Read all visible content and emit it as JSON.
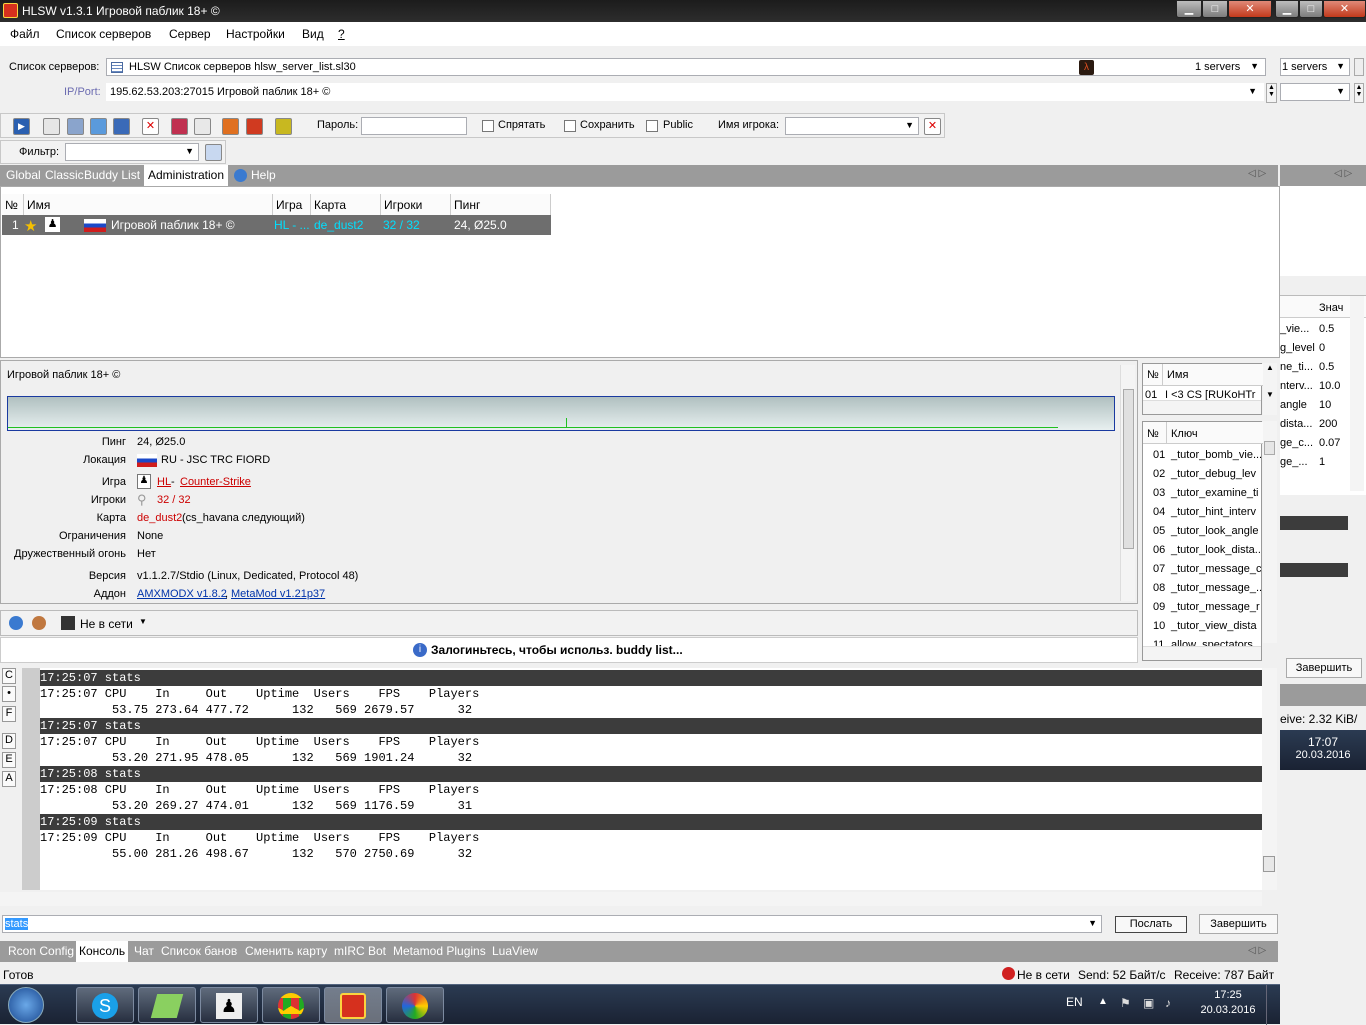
{
  "window": {
    "title": "HLSW v1.3.1   Игровой паблик 18+ ©"
  },
  "menu": [
    "Файл",
    "Список серверов",
    "Сервер",
    "Настройки",
    "Вид",
    "?"
  ],
  "serverlist": {
    "label": "Список серверов:",
    "value": "HLSW Список серверов  hlsw_server_list.sl30",
    "count": "1 servers",
    "count2": "1 servers"
  },
  "ipport": {
    "label": "IP/Port:",
    "value": "195.62.53.203:27015 Игровой паблик 18+ ©"
  },
  "toolbar": {
    "password_label": "Пароль:",
    "hide_label": "Спрятать",
    "save_label": "Сохранить",
    "public_label": "Public",
    "player_label": "Имя игрока:"
  },
  "filter": {
    "label": "Фильтр:"
  },
  "tabs": [
    "Global",
    "Classic",
    "Buddy List",
    "Administration",
    "Help"
  ],
  "grid": {
    "headers": [
      "№",
      "Имя",
      "Игра",
      "Карта",
      "Игроки",
      "Пинг"
    ],
    "row": {
      "num": "1",
      "name": "Игровой паблик 18+ ©",
      "game": "HL - ...",
      "map": "de_dust2",
      "players": "32 / 32",
      "ping": "24, Ø25.0"
    }
  },
  "info": {
    "title": "Игровой паблик 18+ ©",
    "rows": [
      {
        "k": "Пинг",
        "v": "24, Ø25.0"
      },
      {
        "k": "Локация",
        "v": "RU - JSC TRC FIORD"
      },
      {
        "k": "Игра",
        "v1": "HL",
        "sep": " - ",
        "v2": "Counter-Strike"
      },
      {
        "k": "Игроки",
        "v": "32 / 32"
      },
      {
        "k": "Карта",
        "v1": "de_dust2",
        "v2": " (cs_havana следующий)"
      },
      {
        "k": "Ограничения",
        "v": "None"
      },
      {
        "k": "Дружественный огонь",
        "v": "Нет"
      },
      {
        "k": "Версия",
        "v": "v1.1.2.7/Stdio (Linux, Dedicated, Protocol 48)"
      },
      {
        "k": "Аддон",
        "v1": "AMXMODX v1.8.2",
        "sep": ", ",
        "v2": "MetaMod v1.21p37"
      }
    ]
  },
  "players_panel": {
    "h_num": "№",
    "h_name": "Имя",
    "row_num": "01",
    "row_name": "I <3 CS [RUKoHTr"
  },
  "cvar_panel": {
    "h_num": "№",
    "h_key": "Ключ",
    "rows": [
      [
        "01",
        "_tutor_bomb_vie..."
      ],
      [
        "02",
        "_tutor_debug_lev"
      ],
      [
        "03",
        "_tutor_examine_ti"
      ],
      [
        "04",
        "_tutor_hint_interv"
      ],
      [
        "05",
        "_tutor_look_angle"
      ],
      [
        "06",
        "_tutor_look_dista..."
      ],
      [
        "07",
        "_tutor_message_c"
      ],
      [
        "08",
        "_tutor_message_..."
      ],
      [
        "09",
        "_tutor_message_r"
      ],
      [
        "10",
        "_tutor_view_dista"
      ],
      [
        "11",
        "allow_spectators"
      ]
    ]
  },
  "side_panel": {
    "h_val": "Знач",
    "rows": [
      [
        "_vie...",
        "0.5"
      ],
      [
        "g_level",
        "0"
      ],
      [
        "ne_ti...",
        "0.5"
      ],
      [
        "nterv...",
        "10.0"
      ],
      [
        "angle",
        "10"
      ],
      [
        "dista...",
        "200"
      ],
      [
        "ge_c...",
        "0.07"
      ],
      [
        "ge_...",
        "1"
      ]
    ],
    "finish": "Завершить",
    "recv": "eive:  2.32 KiB/",
    "time": "17:07",
    "date": "20.03.2016"
  },
  "buddy": {
    "status": "Не в сети",
    "notice": "Залогиньтесь, чтобы использ. buddy list..."
  },
  "side_letters": [
    "C",
    "•",
    "F",
    "D",
    "E",
    "A"
  ],
  "console": {
    "lines": [
      {
        "t": "h",
        "s": "17:25:07 stats"
      },
      {
        "t": "n",
        "s": "17:25:07 CPU    In     Out    Uptime  Users    FPS    Players"
      },
      {
        "t": "n",
        "s": "          53.75 273.64 477.72      132   569 2679.57      32"
      },
      {
        "t": "h",
        "s": "17:25:07 stats"
      },
      {
        "t": "n",
        "s": "17:25:07 CPU    In     Out    Uptime  Users    FPS    Players"
      },
      {
        "t": "n",
        "s": "          53.20 271.95 478.05      132   569 1901.24      32"
      },
      {
        "t": "h",
        "s": "17:25:08 stats"
      },
      {
        "t": "n",
        "s": "17:25:08 CPU    In     Out    Uptime  Users    FPS    Players"
      },
      {
        "t": "n",
        "s": "          53.20 269.27 474.01      132   569 1176.59      31"
      },
      {
        "t": "h",
        "s": "17:25:09 stats"
      },
      {
        "t": "n",
        "s": "17:25:09 CPU    In     Out    Uptime  Users    FPS    Players"
      },
      {
        "t": "n",
        "s": "          55.00 281.26 498.67      132   570 2750.69      32"
      }
    ],
    "input": "stats",
    "send": "Послать",
    "finish": "Завершить"
  },
  "bottom_tabs": [
    "Rcon Config",
    "Консоль",
    "Чат",
    "Список банов",
    "Сменить карту",
    "mIRC Bot",
    "Metamod Plugins",
    "LuaView"
  ],
  "statusbar": {
    "ready": "Готов",
    "net": "Не в сети",
    "send": "Send:  52 Байт/с",
    "recv": "Receive:  787 Байт"
  },
  "tray": {
    "lang": "EN",
    "time": "17:25",
    "date": "20.03.2016"
  }
}
